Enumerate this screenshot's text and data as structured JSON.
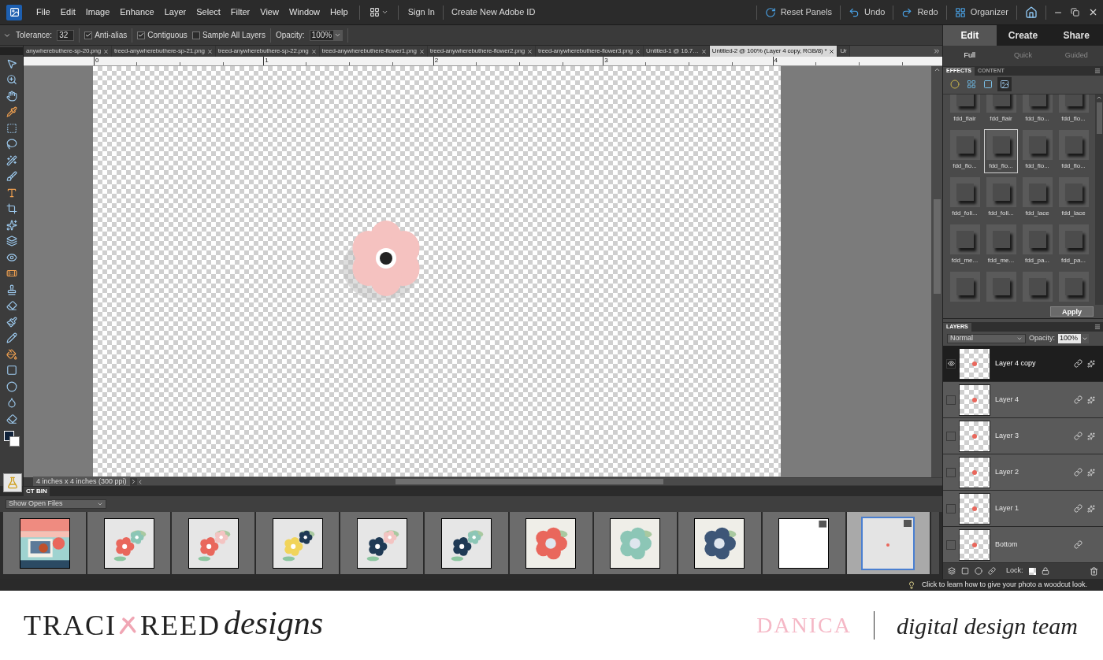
{
  "app_menu": [
    "File",
    "Edit",
    "Image",
    "Enhance",
    "Layer",
    "Select",
    "Filter",
    "View",
    "Window",
    "Help"
  ],
  "account_links": [
    "Sign In",
    "Create New Adobe ID"
  ],
  "top_actions": [
    {
      "label": "Reset Panels",
      "kind": "reset"
    },
    {
      "label": "Undo",
      "kind": "undo"
    },
    {
      "label": "Redo",
      "kind": "redo"
    },
    {
      "label": "Organizer",
      "kind": "organizer"
    }
  ],
  "options_bar": {
    "tolerance_label": "Tolerance:",
    "tolerance": "32",
    "checkboxes": [
      {
        "label": "Anti-alias",
        "checked": true
      },
      {
        "label": "Contiguous",
        "checked": true
      },
      {
        "label": "Sample All Layers",
        "checked": false
      }
    ],
    "opacity_label": "Opacity:",
    "opacity": "100%"
  },
  "document_tabs": [
    {
      "label": "anywherebuthere-sp-20.png",
      "selected": false,
      "closable": true
    },
    {
      "label": "treed-anywherebuthere-sp-21.png",
      "selected": false,
      "closable": true
    },
    {
      "label": "treed-anywherebuthere-sp-22.png",
      "selected": false,
      "closable": true
    },
    {
      "label": "treed-anywherebuthere-flower1.png",
      "selected": false,
      "closable": true
    },
    {
      "label": "treed-anywherebuthere-flower2.png",
      "selected": false,
      "closable": true
    },
    {
      "label": "treed-anywherebuthere-flower3.png",
      "selected": false,
      "closable": true
    },
    {
      "label": "Untitled-1 @ 16.7…",
      "selected": false,
      "closable": true
    },
    {
      "label": "Untitled-2 @ 100% (Layer 4 copy, RGB/8) *",
      "selected": true,
      "closable": true
    },
    {
      "label": "Ur",
      "selected": false,
      "closable": false
    }
  ],
  "ruler_marks": [
    "0",
    "1",
    "2",
    "3",
    "4"
  ],
  "status": "4 inches x 4 inches (300 ppi)",
  "project_bin": {
    "title": "CT BIN",
    "filter": "Show Open Files",
    "items": [
      {
        "kind": "picture",
        "selected": false
      },
      {
        "kind": "picture",
        "selected": false
      },
      {
        "kind": "picture",
        "selected": false
      },
      {
        "kind": "picture",
        "selected": false
      },
      {
        "kind": "picture",
        "selected": false
      },
      {
        "kind": "picture",
        "selected": false
      },
      {
        "kind": "picture",
        "selected": false
      },
      {
        "kind": "picture",
        "selected": false
      },
      {
        "kind": "picture",
        "selected": false
      },
      {
        "kind": "picture",
        "selected": false
      },
      {
        "kind": "picture",
        "selected": true
      }
    ]
  },
  "mode_tabs": [
    {
      "label": "Edit",
      "selected": true
    },
    {
      "label": "Create",
      "selected": false
    },
    {
      "label": "Share",
      "selected": false
    }
  ],
  "edit_modes": [
    {
      "label": "Full",
      "selected": true
    },
    {
      "label": "Quick",
      "selected": false
    },
    {
      "label": "Guided",
      "selected": false
    }
  ],
  "effects": {
    "tabs": [
      {
        "label": "EFFECTS",
        "selected": true
      },
      {
        "label": "CONTENT",
        "selected": false
      }
    ],
    "categories": [
      {
        "selected": false
      },
      {
        "selected": false
      },
      {
        "selected": false
      },
      {
        "selected": true
      }
    ],
    "items": [
      {
        "label": "fdd_flair",
        "selected": false
      },
      {
        "label": "fdd_flair",
        "selected": false
      },
      {
        "label": "fdd_flo...",
        "selected": false
      },
      {
        "label": "fdd_flo...",
        "selected": false
      },
      {
        "label": "fdd_flo...",
        "selected": false
      },
      {
        "label": "fdd_flo...",
        "selected": true
      },
      {
        "label": "fdd_flo...",
        "selected": false
      },
      {
        "label": "fdd_flo...",
        "selected": false
      },
      {
        "label": "fdd_foli...",
        "selected": false
      },
      {
        "label": "fdd_foli...",
        "selected": false
      },
      {
        "label": "fdd_lace",
        "selected": false
      },
      {
        "label": "fdd_lace",
        "selected": false
      },
      {
        "label": "fdd_me...",
        "selected": false
      },
      {
        "label": "fdd_me...",
        "selected": false
      },
      {
        "label": "fdd_pa...",
        "selected": false
      },
      {
        "label": "fdd_pa...",
        "selected": false
      },
      {
        "selected": false
      },
      {
        "selected": false
      },
      {
        "selected": false
      },
      {
        "selected": false
      }
    ],
    "apply": "Apply"
  },
  "layers": {
    "title": "LAYERS",
    "blend_mode": "Normal",
    "opacity_label": "Opacity:",
    "opacity": "100%",
    "lock_label": "Lock:",
    "rows": [
      {
        "name": "Layer 4 copy",
        "visible": true,
        "selected": true,
        "fx": true
      },
      {
        "name": "Layer 4",
        "visible": false,
        "selected": false,
        "fx": true
      },
      {
        "name": "Layer 3",
        "visible": false,
        "selected": false,
        "fx": true
      },
      {
        "name": "Layer 2",
        "visible": false,
        "selected": false,
        "fx": true
      },
      {
        "name": "Layer 1",
        "visible": false,
        "selected": false,
        "fx": true
      },
      {
        "name": "Bottom",
        "visible": false,
        "selected": false,
        "fx": false
      }
    ]
  },
  "tip": "Click to learn how to give your photo a woodcut look.",
  "banner": {
    "brand_parts": [
      "TRACI",
      "REED",
      "designs"
    ],
    "designer": "DANICA",
    "team": "digital design team"
  }
}
